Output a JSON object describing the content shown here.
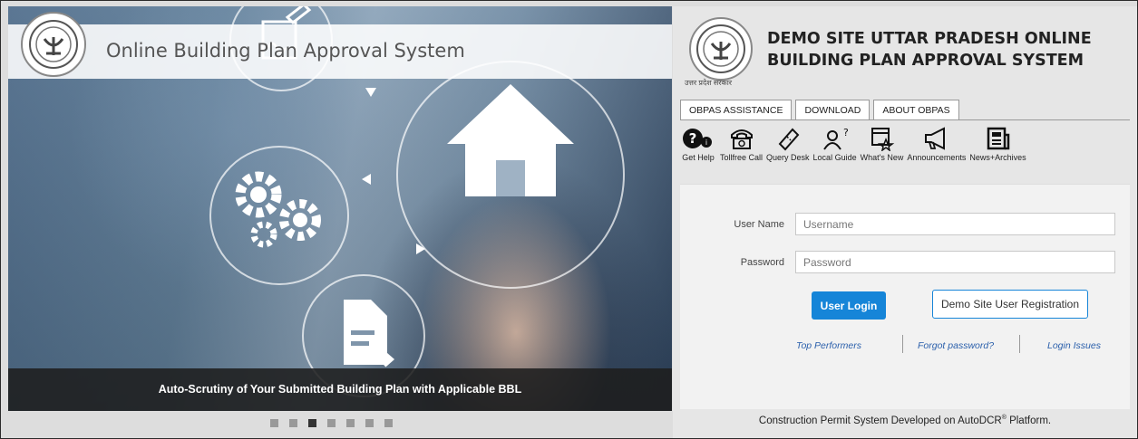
{
  "hero": {
    "title": "Online Building Plan Approval System",
    "caption": "Auto-Scrutiny of Your Submitted Building Plan with Applicable BBL",
    "slide_count": 7,
    "active_slide": 3
  },
  "brand": {
    "title_line1": "DEMO SITE UTTAR PRADESH ONLINE",
    "title_line2": "BUILDING PLAN APPROVAL SYSTEM",
    "emblem_caption": "उत्तर प्रदेश सरकार"
  },
  "tabs": [
    {
      "label": "OBPAS ASSISTANCE"
    },
    {
      "label": "DOWNLOAD"
    },
    {
      "label": "ABOUT OBPAS"
    }
  ],
  "quick_links": [
    {
      "label": "Get Help",
      "icon": "help-icon"
    },
    {
      "label": "Tollfree Call",
      "icon": "phone-icon"
    },
    {
      "label": "Query Desk",
      "icon": "ticket-icon"
    },
    {
      "label": "Local Guide",
      "icon": "guide-icon"
    },
    {
      "label": "What's New",
      "icon": "new-icon"
    },
    {
      "label": "Announcements",
      "icon": "megaphone-icon"
    },
    {
      "label": "News+Archives",
      "icon": "news-icon"
    }
  ],
  "login": {
    "username_label": "User Name",
    "username_placeholder": "Username",
    "password_label": "Password",
    "password_placeholder": "Password",
    "login_button": "User Login",
    "register_button": "Demo Site User Registration",
    "links": [
      "Top Performers",
      "Forgot password?",
      "Login Issues"
    ]
  },
  "footer": {
    "text_before": "Construction Permit System Developed on AutoDCR",
    "registered_mark": "®",
    "text_after": " Platform."
  }
}
